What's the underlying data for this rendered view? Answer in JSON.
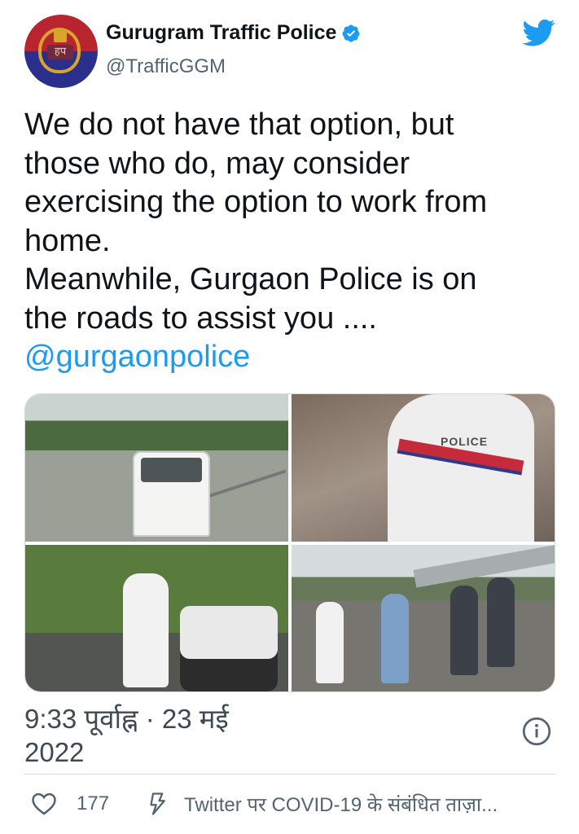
{
  "author": {
    "display_name": "Gurugram Traffic Police",
    "handle": "@TrafficGGM",
    "avatar_text": "हप"
  },
  "tweet": {
    "text": "We do not have that option, but\nthose who do, may consider\nexercising the option to work from\nhome.\nMeanwhile, Gurgaon Police is on\nthe roads to assist you ....",
    "mention": "@gurgaonpolice"
  },
  "media": {
    "photo_badge_text": "POLICE"
  },
  "meta": {
    "timestamp_line1": "9:33 पूर्वाह्न · 23 मई",
    "timestamp_line2": "2022"
  },
  "actions": {
    "like_count": "177",
    "covid_text": "Twitter पर COVID-19 के संबंधित ताज़ा..."
  },
  "icons": [
    "verified-badge-icon",
    "twitter-bird-icon",
    "info-icon",
    "heart-icon",
    "lightning-icon"
  ],
  "colors": {
    "accent": "#1d9bf0",
    "text": "#0f1419",
    "secondary": "#536471"
  }
}
